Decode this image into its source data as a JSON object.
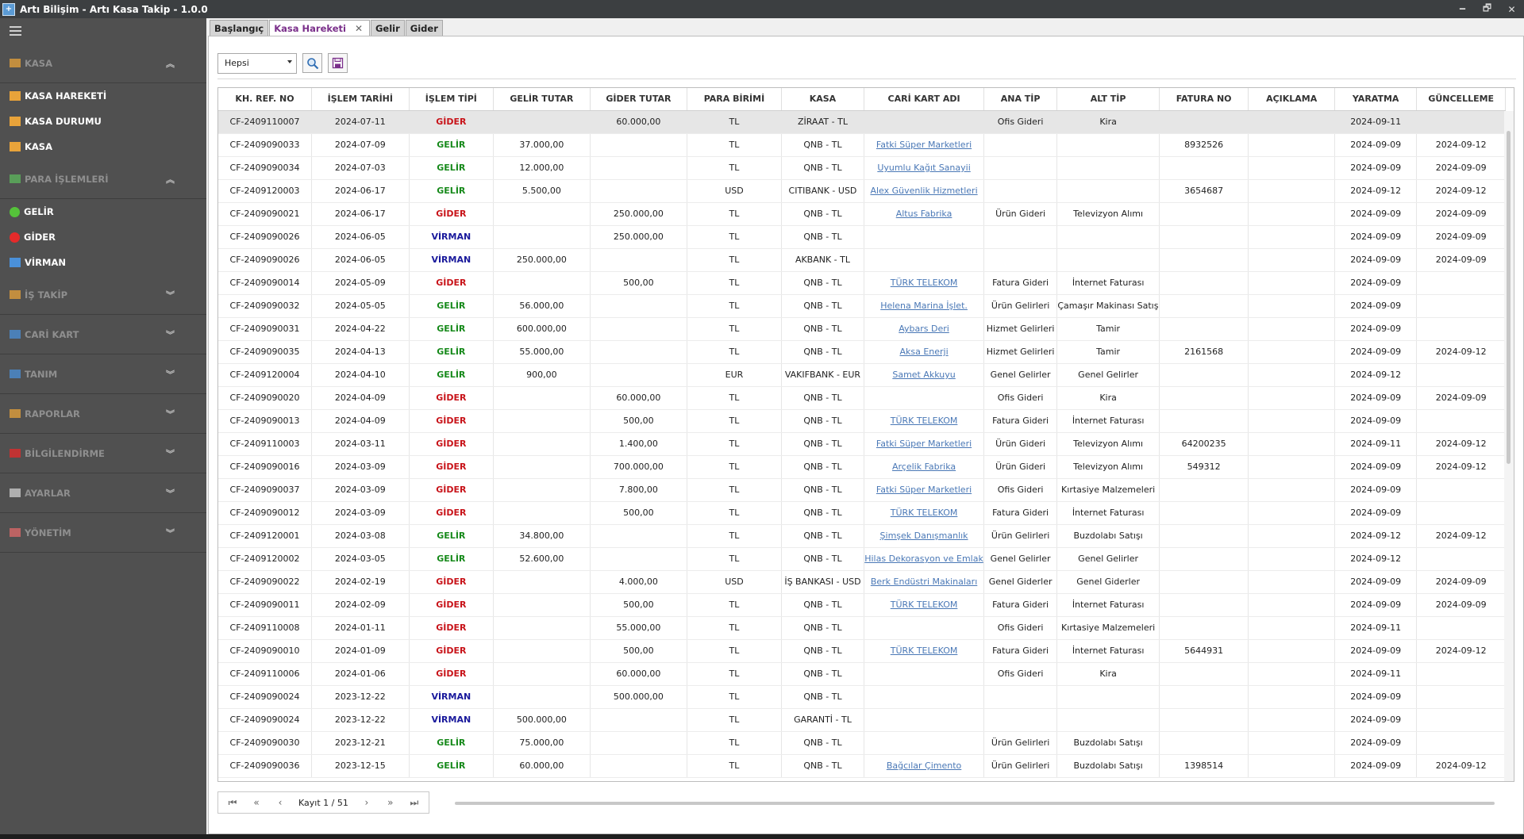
{
  "window": {
    "title": "Artı Bilişim - Artı Kasa Takip - 1.0.0",
    "minimize": "🗕",
    "restore": "🗗",
    "close": "✕"
  },
  "sidebar": {
    "groups": [
      {
        "label": "KASA",
        "icon": "cash-register-icon",
        "color": "#e8a33a",
        "expanded": true,
        "items": [
          {
            "label": "KASA HAREKETİ",
            "icon": "money-hand-icon",
            "color": "#e8a33a"
          },
          {
            "label": "KASA DURUMU",
            "icon": "scale-icon",
            "color": "#e8a33a"
          },
          {
            "label": "KASA",
            "icon": "cash-register-icon",
            "color": "#e8a33a"
          }
        ]
      },
      {
        "label": "PARA İŞLEMLERİ",
        "icon": "money-icon",
        "color": "#5cb85c",
        "expanded": true,
        "items": [
          {
            "label": "GELİR",
            "icon": "green-dot-icon",
            "color": "#55c23a"
          },
          {
            "label": "GİDER",
            "icon": "red-dot-icon",
            "color": "#e52a2a"
          },
          {
            "label": "VİRMAN",
            "icon": "transfer-icon",
            "color": "#4a90d9"
          }
        ]
      },
      {
        "label": "İŞ TAKİP",
        "icon": "task-icon",
        "color": "#e8a33a",
        "expanded": false,
        "items": []
      },
      {
        "label": "CARİ KART",
        "icon": "id-card-icon",
        "color": "#4a90d9",
        "expanded": false,
        "items": []
      },
      {
        "label": "TANIM",
        "icon": "list-icon",
        "color": "#4a90d9",
        "expanded": false,
        "items": []
      },
      {
        "label": "RAPORLAR",
        "icon": "bar-chart-icon",
        "color": "#e8a33a",
        "expanded": false,
        "items": []
      },
      {
        "label": "BİLGİLENDİRME",
        "icon": "youtube-icon",
        "color": "#e52a2a",
        "expanded": false,
        "items": []
      },
      {
        "label": "AYARLAR",
        "icon": "gear-icon",
        "color": "#cfcfcf",
        "expanded": false,
        "items": []
      },
      {
        "label": "YÖNETİM",
        "icon": "admin-icon",
        "color": "#e06a6a",
        "expanded": false,
        "items": []
      }
    ]
  },
  "tabs": [
    {
      "label": "Başlangıç",
      "active": false
    },
    {
      "label": "Kasa Hareketi",
      "active": true,
      "closable": true
    },
    {
      "label": "Gelir",
      "active": false
    },
    {
      "label": "Gider",
      "active": false
    }
  ],
  "tab_close": "✕",
  "toolbar": {
    "filter_value": "Hepsi",
    "search_icon": "search-icon",
    "export_icon": "save-icon"
  },
  "grid": {
    "columns": [
      "KH. REF. NO",
      "İŞLEM TARİHİ",
      "İŞLEM TİPİ",
      "GELİR TUTAR",
      "GİDER TUTAR",
      "PARA BİRİMİ",
      "KASA",
      "CARİ KART ADI",
      "ANA TİP",
      "ALT TİP",
      "FATURA NO",
      "AÇIKLAMA",
      "YARATMA",
      "GÜNCELLEME"
    ],
    "rows": [
      {
        "ref": "CF-2409110007",
        "date": "2024-07-11",
        "type": "GİDER",
        "gelir": "",
        "gider": "60.000,00",
        "cur": "TL",
        "kasa": "ZİRAAT - TL",
        "cari": "",
        "ana": "Ofis Gideri",
        "alt": "Kira",
        "fatura": "",
        "aciklama": "",
        "created": "2024-09-11",
        "updated": "",
        "selected": true
      },
      {
        "ref": "CF-2409090033",
        "date": "2024-07-09",
        "type": "GELİR",
        "gelir": "37.000,00",
        "gider": "",
        "cur": "TL",
        "kasa": "QNB - TL",
        "cari": "Fatki Süper Marketleri",
        "ana": "",
        "alt": "",
        "fatura": "8932526",
        "aciklama": "",
        "created": "2024-09-09",
        "updated": "2024-09-12"
      },
      {
        "ref": "CF-2409090034",
        "date": "2024-07-03",
        "type": "GELİR",
        "gelir": "12.000,00",
        "gider": "",
        "cur": "TL",
        "kasa": "QNB - TL",
        "cari": "Uyumlu Kağıt Sanayii",
        "ana": "",
        "alt": "",
        "fatura": "",
        "aciklama": "",
        "created": "2024-09-09",
        "updated": "2024-09-09"
      },
      {
        "ref": "CF-2409120003",
        "date": "2024-06-17",
        "type": "GELİR",
        "gelir": "5.500,00",
        "gider": "",
        "cur": "USD",
        "kasa": "CITIBANK - USD",
        "cari": "Alex Güvenlik Hizmetleri",
        "ana": "",
        "alt": "",
        "fatura": "3654687",
        "aciklama": "",
        "created": "2024-09-12",
        "updated": "2024-09-12"
      },
      {
        "ref": "CF-2409090021",
        "date": "2024-06-17",
        "type": "GİDER",
        "gelir": "",
        "gider": "250.000,00",
        "cur": "TL",
        "kasa": "QNB - TL",
        "cari": "Altus Fabrika",
        "ana": "Ürün Gideri",
        "alt": "Televizyon Alımı",
        "fatura": "",
        "aciklama": "",
        "created": "2024-09-09",
        "updated": "2024-09-09"
      },
      {
        "ref": "CF-2409090026",
        "date": "2024-06-05",
        "type": "VİRMAN",
        "gelir": "",
        "gider": "250.000,00",
        "cur": "TL",
        "kasa": "QNB - TL",
        "cari": "",
        "ana": "",
        "alt": "",
        "fatura": "",
        "aciklama": "",
        "created": "2024-09-09",
        "updated": "2024-09-09"
      },
      {
        "ref": "CF-2409090026",
        "date": "2024-06-05",
        "type": "VİRMAN",
        "gelir": "250.000,00",
        "gider": "",
        "cur": "TL",
        "kasa": "AKBANK - TL",
        "cari": "",
        "ana": "",
        "alt": "",
        "fatura": "",
        "aciklama": "",
        "created": "2024-09-09",
        "updated": "2024-09-09"
      },
      {
        "ref": "CF-2409090014",
        "date": "2024-05-09",
        "type": "GİDER",
        "gelir": "",
        "gider": "500,00",
        "cur": "TL",
        "kasa": "QNB - TL",
        "cari": "TÜRK TELEKOM",
        "ana": "Fatura Gideri",
        "alt": "İnternet Faturası",
        "fatura": "",
        "aciklama": "",
        "created": "2024-09-09",
        "updated": ""
      },
      {
        "ref": "CF-2409090032",
        "date": "2024-05-05",
        "type": "GELİR",
        "gelir": "56.000,00",
        "gider": "",
        "cur": "TL",
        "kasa": "QNB - TL",
        "cari": "Helena Marina İşlet.",
        "ana": "Ürün Gelirleri",
        "alt": "Çamaşır Makinası Satışı",
        "fatura": "",
        "aciklama": "",
        "created": "2024-09-09",
        "updated": ""
      },
      {
        "ref": "CF-2409090031",
        "date": "2024-04-22",
        "type": "GELİR",
        "gelir": "600.000,00",
        "gider": "",
        "cur": "TL",
        "kasa": "QNB - TL",
        "cari": "Aybars Deri",
        "ana": "Hizmet Gelirleri",
        "alt": "Tamir",
        "fatura": "",
        "aciklama": "",
        "created": "2024-09-09",
        "updated": ""
      },
      {
        "ref": "CF-2409090035",
        "date": "2024-04-13",
        "type": "GELİR",
        "gelir": "55.000,00",
        "gider": "",
        "cur": "TL",
        "kasa": "QNB - TL",
        "cari": "Aksa Enerji",
        "ana": "Hizmet Gelirleri",
        "alt": "Tamir",
        "fatura": "2161568",
        "aciklama": "",
        "created": "2024-09-09",
        "updated": "2024-09-12"
      },
      {
        "ref": "CF-2409120004",
        "date": "2024-04-10",
        "type": "GELİR",
        "gelir": "900,00",
        "gider": "",
        "cur": "EUR",
        "kasa": "VAKIFBANK - EUR",
        "cari": "Samet Akkuyu",
        "ana": "Genel Gelirler",
        "alt": "Genel Gelirler",
        "fatura": "",
        "aciklama": "",
        "created": "2024-09-12",
        "updated": ""
      },
      {
        "ref": "CF-2409090020",
        "date": "2024-04-09",
        "type": "GİDER",
        "gelir": "",
        "gider": "60.000,00",
        "cur": "TL",
        "kasa": "QNB - TL",
        "cari": "",
        "ana": "Ofis Gideri",
        "alt": "Kira",
        "fatura": "",
        "aciklama": "",
        "created": "2024-09-09",
        "updated": "2024-09-09"
      },
      {
        "ref": "CF-2409090013",
        "date": "2024-04-09",
        "type": "GİDER",
        "gelir": "",
        "gider": "500,00",
        "cur": "TL",
        "kasa": "QNB - TL",
        "cari": "TÜRK TELEKOM",
        "ana": "Fatura Gideri",
        "alt": "İnternet Faturası",
        "fatura": "",
        "aciklama": "",
        "created": "2024-09-09",
        "updated": ""
      },
      {
        "ref": "CF-2409110003",
        "date": "2024-03-11",
        "type": "GİDER",
        "gelir": "",
        "gider": "1.400,00",
        "cur": "TL",
        "kasa": "QNB - TL",
        "cari": "Fatki Süper Marketleri",
        "ana": "Ürün Gideri",
        "alt": "Televizyon Alımı",
        "fatura": "64200235",
        "aciklama": "",
        "created": "2024-09-11",
        "updated": "2024-09-12"
      },
      {
        "ref": "CF-2409090016",
        "date": "2024-03-09",
        "type": "GİDER",
        "gelir": "",
        "gider": "700.000,00",
        "cur": "TL",
        "kasa": "QNB - TL",
        "cari": "Arçelik Fabrika",
        "ana": "Ürün Gideri",
        "alt": "Televizyon Alımı",
        "fatura": "549312",
        "aciklama": "",
        "created": "2024-09-09",
        "updated": "2024-09-12"
      },
      {
        "ref": "CF-2409090037",
        "date": "2024-03-09",
        "type": "GİDER",
        "gelir": "",
        "gider": "7.800,00",
        "cur": "TL",
        "kasa": "QNB - TL",
        "cari": "Fatki Süper Marketleri",
        "ana": "Ofis Gideri",
        "alt": "Kırtasiye Malzemeleri",
        "fatura": "",
        "aciklama": "",
        "created": "2024-09-09",
        "updated": ""
      },
      {
        "ref": "CF-2409090012",
        "date": "2024-03-09",
        "type": "GİDER",
        "gelir": "",
        "gider": "500,00",
        "cur": "TL",
        "kasa": "QNB - TL",
        "cari": "TÜRK TELEKOM",
        "ana": "Fatura Gideri",
        "alt": "İnternet Faturası",
        "fatura": "",
        "aciklama": "",
        "created": "2024-09-09",
        "updated": ""
      },
      {
        "ref": "CF-2409120001",
        "date": "2024-03-08",
        "type": "GELİR",
        "gelir": "34.800,00",
        "gider": "",
        "cur": "TL",
        "kasa": "QNB - TL",
        "cari": "Şimşek Danışmanlık",
        "ana": "Ürün Gelirleri",
        "alt": "Buzdolabı Satışı",
        "fatura": "",
        "aciklama": "",
        "created": "2024-09-12",
        "updated": "2024-09-12"
      },
      {
        "ref": "CF-2409120002",
        "date": "2024-03-05",
        "type": "GELİR",
        "gelir": "52.600,00",
        "gider": "",
        "cur": "TL",
        "kasa": "QNB - TL",
        "cari": "Hilas Dekorasyon ve Emlak",
        "ana": "Genel Gelirler",
        "alt": "Genel Gelirler",
        "fatura": "",
        "aciklama": "",
        "created": "2024-09-12",
        "updated": ""
      },
      {
        "ref": "CF-2409090022",
        "date": "2024-02-19",
        "type": "GİDER",
        "gelir": "",
        "gider": "4.000,00",
        "cur": "USD",
        "kasa": "İŞ BANKASI - USD",
        "cari": "Berk Endüstri Makinaları",
        "ana": "Genel Giderler",
        "alt": "Genel Giderler",
        "fatura": "",
        "aciklama": "",
        "created": "2024-09-09",
        "updated": "2024-09-09"
      },
      {
        "ref": "CF-2409090011",
        "date": "2024-02-09",
        "type": "GİDER",
        "gelir": "",
        "gider": "500,00",
        "cur": "TL",
        "kasa": "QNB - TL",
        "cari": "TÜRK TELEKOM",
        "ana": "Fatura Gideri",
        "alt": "İnternet Faturası",
        "fatura": "",
        "aciklama": "",
        "created": "2024-09-09",
        "updated": "2024-09-09"
      },
      {
        "ref": "CF-2409110008",
        "date": "2024-01-11",
        "type": "GİDER",
        "gelir": "",
        "gider": "55.000,00",
        "cur": "TL",
        "kasa": "QNB - TL",
        "cari": "",
        "ana": "Ofis Gideri",
        "alt": "Kırtasiye Malzemeleri",
        "fatura": "",
        "aciklama": "",
        "created": "2024-09-11",
        "updated": ""
      },
      {
        "ref": "CF-2409090010",
        "date": "2024-01-09",
        "type": "GİDER",
        "gelir": "",
        "gider": "500,00",
        "cur": "TL",
        "kasa": "QNB - TL",
        "cari": "TÜRK TELEKOM",
        "ana": "Fatura Gideri",
        "alt": "İnternet Faturası",
        "fatura": "5644931",
        "aciklama": "",
        "created": "2024-09-09",
        "updated": "2024-09-12"
      },
      {
        "ref": "CF-2409110006",
        "date": "2024-01-06",
        "type": "GİDER",
        "gelir": "",
        "gider": "60.000,00",
        "cur": "TL",
        "kasa": "QNB - TL",
        "cari": "",
        "ana": "Ofis Gideri",
        "alt": "Kira",
        "fatura": "",
        "aciklama": "",
        "created": "2024-09-11",
        "updated": ""
      },
      {
        "ref": "CF-2409090024",
        "date": "2023-12-22",
        "type": "VİRMAN",
        "gelir": "",
        "gider": "500.000,00",
        "cur": "TL",
        "kasa": "QNB - TL",
        "cari": "",
        "ana": "",
        "alt": "",
        "fatura": "",
        "aciklama": "",
        "created": "2024-09-09",
        "updated": ""
      },
      {
        "ref": "CF-2409090024",
        "date": "2023-12-22",
        "type": "VİRMAN",
        "gelir": "500.000,00",
        "gider": "",
        "cur": "TL",
        "kasa": "GARANTİ - TL",
        "cari": "",
        "ana": "",
        "alt": "",
        "fatura": "",
        "aciklama": "",
        "created": "2024-09-09",
        "updated": ""
      },
      {
        "ref": "CF-2409090030",
        "date": "2023-12-21",
        "type": "GELİR",
        "gelir": "75.000,00",
        "gider": "",
        "cur": "TL",
        "kasa": "QNB - TL",
        "cari": "",
        "ana": "Ürün Gelirleri",
        "alt": "Buzdolabı Satışı",
        "fatura": "",
        "aciklama": "",
        "created": "2024-09-09",
        "updated": ""
      },
      {
        "ref": "CF-2409090036",
        "date": "2023-12-15",
        "type": "GELİR",
        "gelir": "60.000,00",
        "gider": "",
        "cur": "TL",
        "kasa": "QNB - TL",
        "cari": "Bağcılar Çimento",
        "ana": "Ürün Gelirleri",
        "alt": "Buzdolabı Satışı",
        "fatura": "1398514",
        "aciklama": "",
        "created": "2024-09-09",
        "updated": "2024-09-12"
      }
    ]
  },
  "pager": {
    "first": "⏮",
    "prev_page": "«",
    "prev": "‹",
    "info": "Kayıt 1 / 51",
    "next": "›",
    "next_page": "»",
    "last": "⏭"
  },
  "colors": {
    "gelir": "#178a1b",
    "gider": "#c8141a",
    "virman": "#1a1a9c",
    "active_tab": "#7a2f8a",
    "link": "#4a78b6"
  }
}
